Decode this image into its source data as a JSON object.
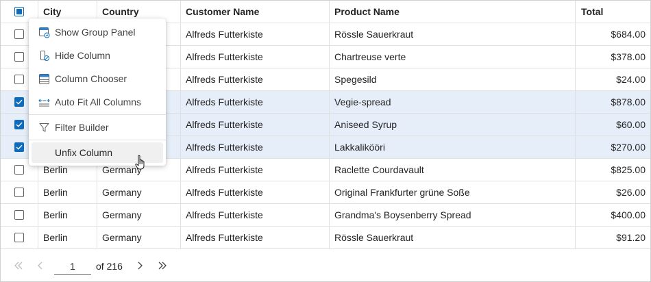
{
  "columns": {
    "city": "City",
    "country": "Country",
    "customer": "Customer Name",
    "product": "Product Name",
    "total": "Total"
  },
  "rows": [
    {
      "city": "",
      "country": "",
      "customer": "Alfreds Futterkiste",
      "product": "Rössle Sauerkraut",
      "total": "$684.00",
      "selected": false
    },
    {
      "city": "",
      "country": "",
      "customer": "Alfreds Futterkiste",
      "product": "Chartreuse verte",
      "total": "$378.00",
      "selected": false
    },
    {
      "city": "",
      "country": "",
      "customer": "Alfreds Futterkiste",
      "product": "Spegesild",
      "total": "$24.00",
      "selected": false
    },
    {
      "city": "",
      "country": "",
      "customer": "Alfreds Futterkiste",
      "product": "Vegie-spread",
      "total": "$878.00",
      "selected": true
    },
    {
      "city": "",
      "country": "",
      "customer": "Alfreds Futterkiste",
      "product": "Aniseed Syrup",
      "total": "$60.00",
      "selected": true
    },
    {
      "city": "",
      "country": "",
      "customer": "Alfreds Futterkiste",
      "product": "Lakkalikööri",
      "total": "$270.00",
      "selected": true
    },
    {
      "city": "Berlin",
      "country": "Germany",
      "customer": "Alfreds Futterkiste",
      "product": "Raclette Courdavault",
      "total": "$825.00",
      "selected": false
    },
    {
      "city": "Berlin",
      "country": "Germany",
      "customer": "Alfreds Futterkiste",
      "product": "Original Frankfurter grüne Soße",
      "total": "$26.00",
      "selected": false
    },
    {
      "city": "Berlin",
      "country": "Germany",
      "customer": "Alfreds Futterkiste",
      "product": "Grandma's Boysenberry Spread",
      "total": "$400.00",
      "selected": false
    },
    {
      "city": "Berlin",
      "country": "Germany",
      "customer": "Alfreds Futterkiste",
      "product": "Rössle Sauerkraut",
      "total": "$91.20",
      "selected": false
    }
  ],
  "context_menu": {
    "items": [
      {
        "label": "Show Group Panel",
        "icon": "group-panel-icon"
      },
      {
        "label": "Hide Column",
        "icon": "hide-column-icon"
      },
      {
        "label": "Column Chooser",
        "icon": "column-chooser-icon"
      },
      {
        "label": "Auto Fit All Columns",
        "icon": "auto-fit-icon"
      },
      {
        "label": "Filter Builder",
        "icon": "filter-icon"
      },
      {
        "label": "Unfix Column",
        "icon": ""
      }
    ]
  },
  "pager": {
    "current_page": "1",
    "total_label": "of 216"
  },
  "colors": {
    "accent": "#0f6cbd",
    "selected_row": "#e6eef9",
    "border": "#e0e0e0"
  }
}
